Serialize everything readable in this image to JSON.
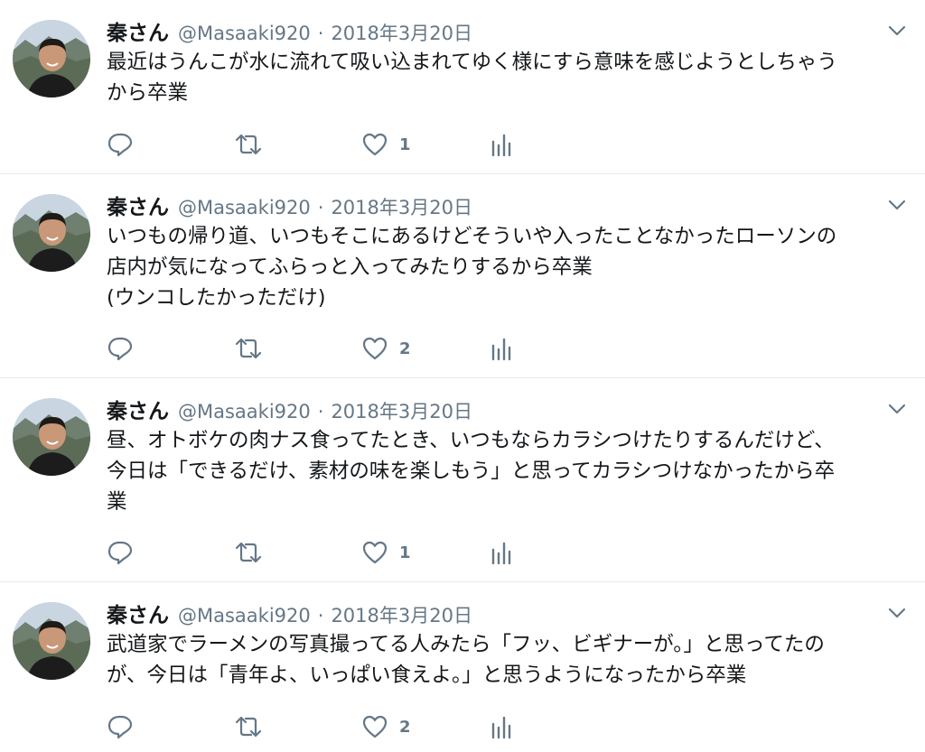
{
  "tweets": [
    {
      "name": "秦さん",
      "handle": "@Masaaki920",
      "separator": "·",
      "date": "2018年3月20日",
      "text": "最近はうんこが水に流れて吸い込まれてゆく様にすら意味を感じようとしちゃう\nから卒業",
      "like_count": "1"
    },
    {
      "name": "秦さん",
      "handle": "@Masaaki920",
      "separator": "·",
      "date": "2018年3月20日",
      "text": "いつもの帰り道、いつもそこにあるけどそういや入ったことなかったローソンの\n店内が気になってふらっと入ってみたりするから卒業\n(ウンコしたかっただけ)",
      "like_count": "2"
    },
    {
      "name": "秦さん",
      "handle": "@Masaaki920",
      "separator": "·",
      "date": "2018年3月20日",
      "text": "昼、オトボケの肉ナス食ってたとき、いつもならカラシつけたりするんだけど、\n今日は「できるだけ、素材の味を楽しもう」と思ってカラシつけなかったから卒\n業",
      "like_count": "1"
    },
    {
      "name": "秦さん",
      "handle": "@Masaaki920",
      "separator": "·",
      "date": "2018年3月20日",
      "text": "武道家でラーメンの写真撮ってる人みたら「フッ、ビギナーが。」と思ってたの\nが、今日は「青年よ、いっぱい食えよ。」と思うようになったから卒業",
      "like_count": "2"
    }
  ],
  "icons": {
    "reply": "reply-icon",
    "retweet": "retweet-icon",
    "like": "heart-icon",
    "analytics": "analytics-icon",
    "menu": "chevron-down-icon"
  },
  "colors": {
    "text": "#14171a",
    "muted": "#657786",
    "divider": "#e6ecf0"
  }
}
